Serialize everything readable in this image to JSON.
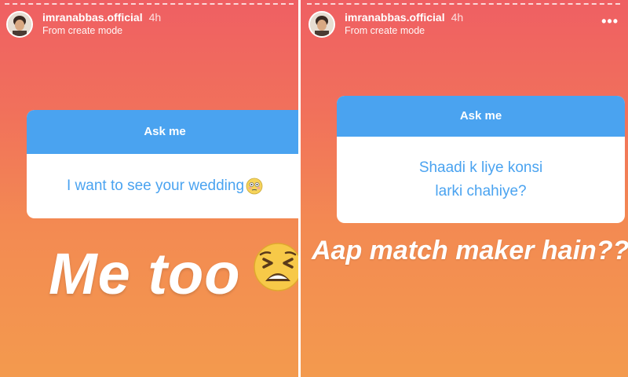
{
  "left_story": {
    "username": "imranabbas.official",
    "time": "4h",
    "subtitle": "From create mode",
    "card_header": "Ask me",
    "question": "I want to see your wedding",
    "question_emoji": "flushed-face-icon",
    "overlay_text": "Me too",
    "overlay_emoji": "tired-face-icon"
  },
  "right_story": {
    "username": "imranabbas.official",
    "time": "4h",
    "subtitle": "From create mode",
    "more": "•••",
    "card_header": "Ask me",
    "question_line1": "Shaadi k liye konsi",
    "question_line2": "larki chahiye?",
    "overlay_text": "Aap match maker hain???"
  },
  "colors": {
    "card_accent": "#4aa3f0",
    "gradient_top": "#ef5f63",
    "gradient_bottom": "#f39a4e"
  }
}
